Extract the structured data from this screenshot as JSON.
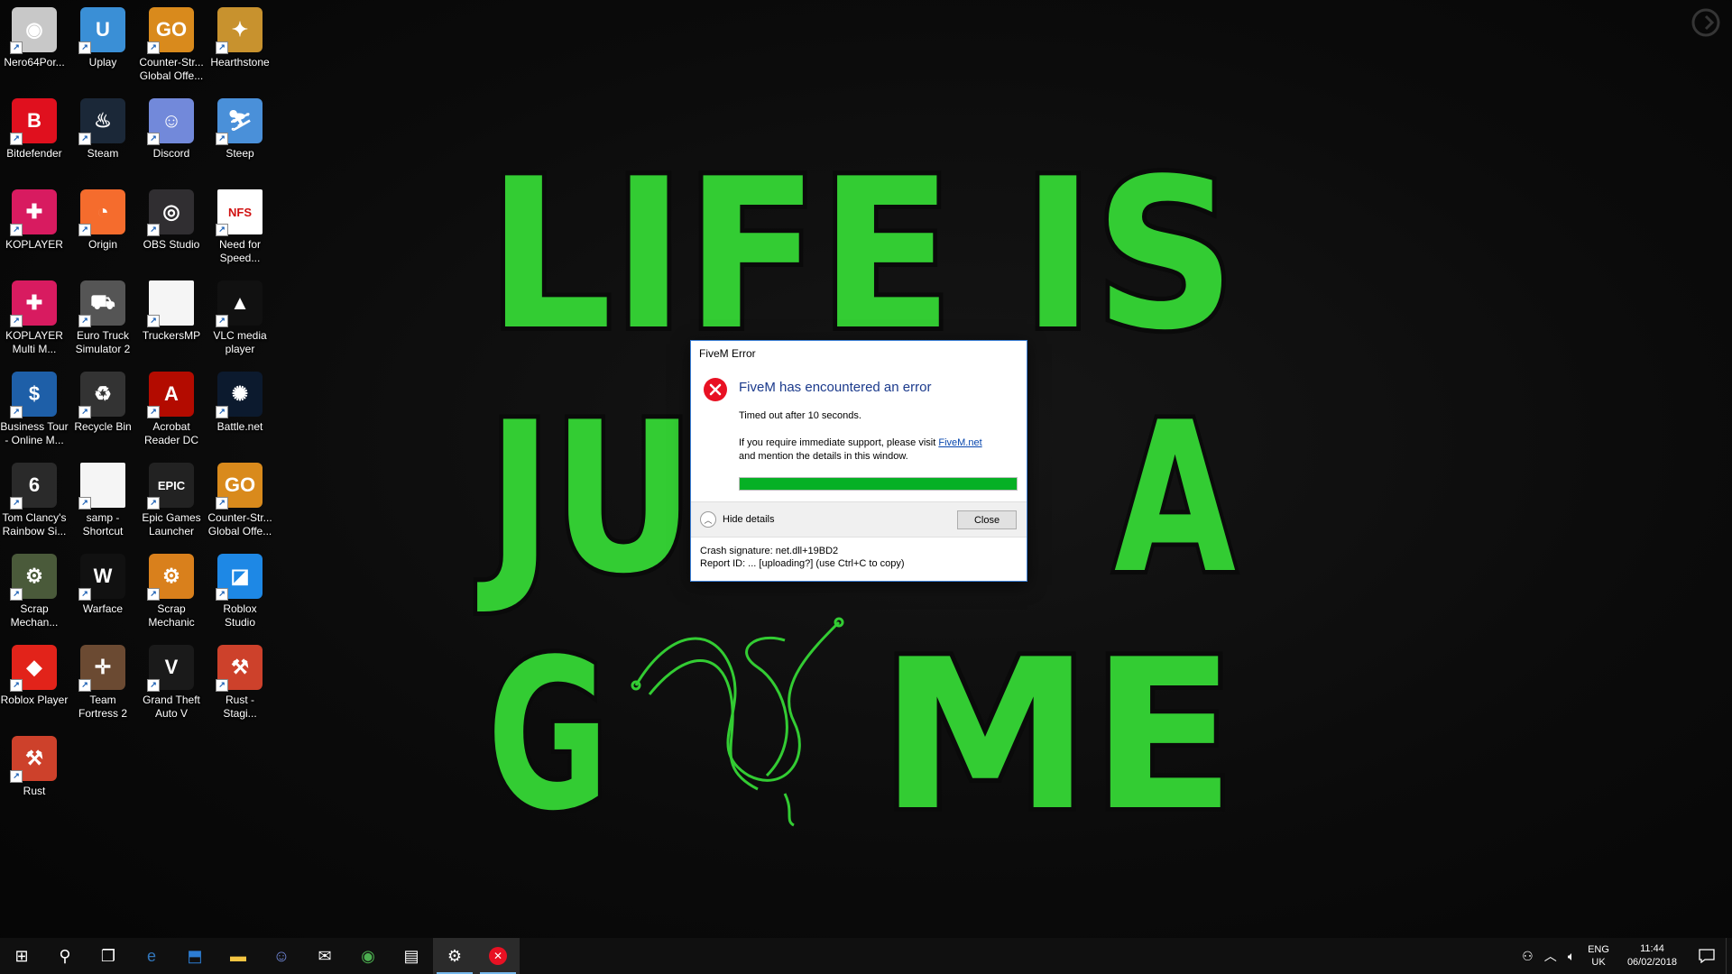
{
  "wallpaper": {
    "line1": "LIFE IS",
    "line2_left": "JU",
    "line2_right": "A",
    "line3_left": "G",
    "line3_right": "ME",
    "accent": "#33cc33"
  },
  "desktop_icons": [
    {
      "label": "Nero64Por...",
      "icon": "nero-icon",
      "color": "#c8c8c8",
      "glyph": "◉"
    },
    {
      "label": "Uplay",
      "icon": "uplay-icon",
      "color": "#3a8fd6",
      "glyph": "U"
    },
    {
      "label": "Counter-Str...\nGlobal Offe...",
      "icon": "csgo-icon",
      "color": "#d98a1c",
      "glyph": "GO"
    },
    {
      "label": "Hearthstone",
      "icon": "hearthstone-icon",
      "color": "#c8922e",
      "glyph": "✦"
    },
    {
      "label": "Bitdefender",
      "icon": "bitdefender-icon",
      "color": "#e0101e",
      "glyph": "B"
    },
    {
      "label": "Steam",
      "icon": "steam-icon",
      "color": "#1b2838",
      "glyph": "♨"
    },
    {
      "label": "Discord",
      "icon": "discord-icon",
      "color": "#7289da",
      "glyph": "☺"
    },
    {
      "label": "Steep",
      "icon": "steep-icon",
      "color": "#4a90d9",
      "glyph": "⛷"
    },
    {
      "label": "KOPLAYER",
      "icon": "koplayer-icon",
      "color": "#d81b60",
      "glyph": "✚"
    },
    {
      "label": "Origin",
      "icon": "origin-icon",
      "color": "#f56c2d",
      "glyph": "◔"
    },
    {
      "label": "OBS Studio",
      "icon": "obs-icon",
      "color": "#302e31",
      "glyph": "◎"
    },
    {
      "label": "Need for\nSpeed...",
      "icon": "nfs-icon",
      "color": "#ffffff",
      "glyph": "NFS"
    },
    {
      "label": "KOPLAYER\nMulti M...",
      "icon": "koplayer-multi-icon",
      "color": "#d81b60",
      "glyph": "✚"
    },
    {
      "label": "Euro Truck\nSimulator 2",
      "icon": "ets2-icon",
      "color": "#555555",
      "glyph": "⛟"
    },
    {
      "label": "TruckersMP",
      "icon": "file-icon",
      "color": "#f5f5f5",
      "glyph": ""
    },
    {
      "label": "VLC media\nplayer",
      "icon": "vlc-icon",
      "color": "#111111",
      "glyph": "▲"
    },
    {
      "label": "Business Tour\n- Online M...",
      "icon": "business-tour-icon",
      "color": "#1e5fa8",
      "glyph": "$"
    },
    {
      "label": "Recycle Bin",
      "icon": "recycle-bin-icon",
      "color": "#333333",
      "glyph": "♻"
    },
    {
      "label": "Acrobat\nReader DC",
      "icon": "acrobat-icon",
      "color": "#b30b00",
      "glyph": "A"
    },
    {
      "label": "Battle.net",
      "icon": "battlenet-icon",
      "color": "#0c1a2e",
      "glyph": "✺"
    },
    {
      "label": "Tom Clancy's\nRainbow Si...",
      "icon": "rainbow-six-icon",
      "color": "#2a2a2a",
      "glyph": "6"
    },
    {
      "label": "samp -\nShortcut",
      "icon": "file-icon",
      "color": "#f5f5f5",
      "glyph": ""
    },
    {
      "label": "Epic Games\nLauncher",
      "icon": "epic-games-icon",
      "color": "#222222",
      "glyph": "EPIC"
    },
    {
      "label": "Counter-Str...\nGlobal Offe...",
      "icon": "csgo-icon",
      "color": "#d98a1c",
      "glyph": "GO"
    },
    {
      "label": "Scrap\nMechan...",
      "icon": "scrap-mechanic-icon",
      "color": "#4a5a3a",
      "glyph": "⚙"
    },
    {
      "label": "Warface",
      "icon": "warface-icon",
      "color": "#111111",
      "glyph": "W"
    },
    {
      "label": "Scrap\nMechanic",
      "icon": "scrap-mechanic-icon",
      "color": "#d9801c",
      "glyph": "⚙"
    },
    {
      "label": "Roblox\nStudio",
      "icon": "roblox-studio-icon",
      "color": "#1e88e5",
      "glyph": "◪"
    },
    {
      "label": "Roblox Player",
      "icon": "roblox-icon",
      "color": "#e2231a",
      "glyph": "◆"
    },
    {
      "label": "Team\nFortress 2",
      "icon": "tf2-icon",
      "color": "#6b4a32",
      "glyph": "✛"
    },
    {
      "label": "Grand Theft\nAuto V",
      "icon": "gta5-icon",
      "color": "#1a1a1a",
      "glyph": "V"
    },
    {
      "label": "Rust -\nStagi...",
      "icon": "rust-icon",
      "color": "#cd412b",
      "glyph": "⚒"
    },
    {
      "label": "Rust",
      "icon": "rust-icon",
      "color": "#cd412b",
      "glyph": "⚒"
    }
  ],
  "dialog": {
    "title": "FiveM Error",
    "heading": "FiveM has encountered an error",
    "message": "Timed out after 10 seconds.",
    "support_text": "If you require immediate support, please visit",
    "support_link": "FiveM.net",
    "support_text2": "and mention the details in this window.",
    "progress": 1.0,
    "details_toggle": "Hide details",
    "close_label": "Close",
    "crash_signature": "Crash signature: net.dll+19BD2",
    "report_id": "Report ID: ... [uploading?] (use Ctrl+C to copy)"
  },
  "taskbar": {
    "apps": [
      {
        "name": "start-icon",
        "glyph": "⊞",
        "running": false
      },
      {
        "name": "search-icon",
        "glyph": "⚲",
        "running": false
      },
      {
        "name": "task-view-icon",
        "glyph": "❐",
        "running": false
      },
      {
        "name": "edge-icon",
        "glyph": "e",
        "running": false
      },
      {
        "name": "store-pinned-icon",
        "glyph": "⬒",
        "running": false
      },
      {
        "name": "file-explorer-icon",
        "glyph": "▬",
        "running": false
      },
      {
        "name": "discord-icon",
        "glyph": "☺",
        "running": false
      },
      {
        "name": "mail-icon",
        "glyph": "✉",
        "running": false
      },
      {
        "name": "chrome-icon",
        "glyph": "◉",
        "running": false
      },
      {
        "name": "store-icon",
        "glyph": "▤",
        "running": false
      },
      {
        "name": "settings-icon",
        "glyph": "⚙",
        "running": true
      },
      {
        "name": "fivem-error-icon",
        "glyph": "✕",
        "running": true
      }
    ],
    "language_top": "ENG",
    "language_bottom": "UK",
    "time": "11:44",
    "date": "06/02/2018"
  }
}
